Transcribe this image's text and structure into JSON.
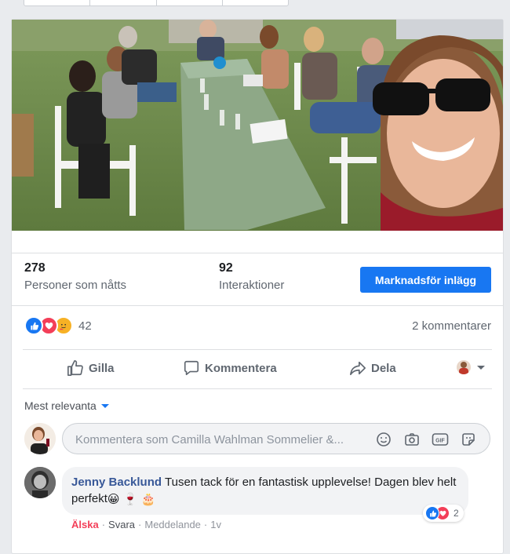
{
  "post": {
    "photo": {
      "subject": "group-selfie-outdoor-table"
    },
    "stats": {
      "reached": {
        "value": "278",
        "label": "Personer som nåtts"
      },
      "engagements": {
        "value": "92",
        "label": "Interaktioner"
      },
      "promote_label": "Marknadsför inlägg"
    },
    "reactions": {
      "count": "42",
      "types": [
        "like-icon",
        "love-icon",
        "care-icon"
      ],
      "comments_label": "2 kommentarer"
    },
    "actions": {
      "like_label": "Gilla",
      "comment_label": "Kommentera",
      "share_label": "Dela"
    },
    "sort_label": "Mest relevanta",
    "composer": {
      "placeholder": "Kommentera som Camilla Wahlman Sommelier &..."
    },
    "comments": [
      {
        "author": "Jenny Backlund",
        "text": "Tusen tack för en fantastisk upplevelse! Dagen blev helt perfekt",
        "emojis": [
          "😀",
          "🍷",
          "🎂"
        ],
        "meta": {
          "love": "Älska",
          "reply": "Svara",
          "message": "Meddelande",
          "time": "1v"
        },
        "reaction_count": "2"
      }
    ]
  },
  "colors": {
    "accent": "#1877f2",
    "love": "#f33e58",
    "link": "#385898"
  }
}
